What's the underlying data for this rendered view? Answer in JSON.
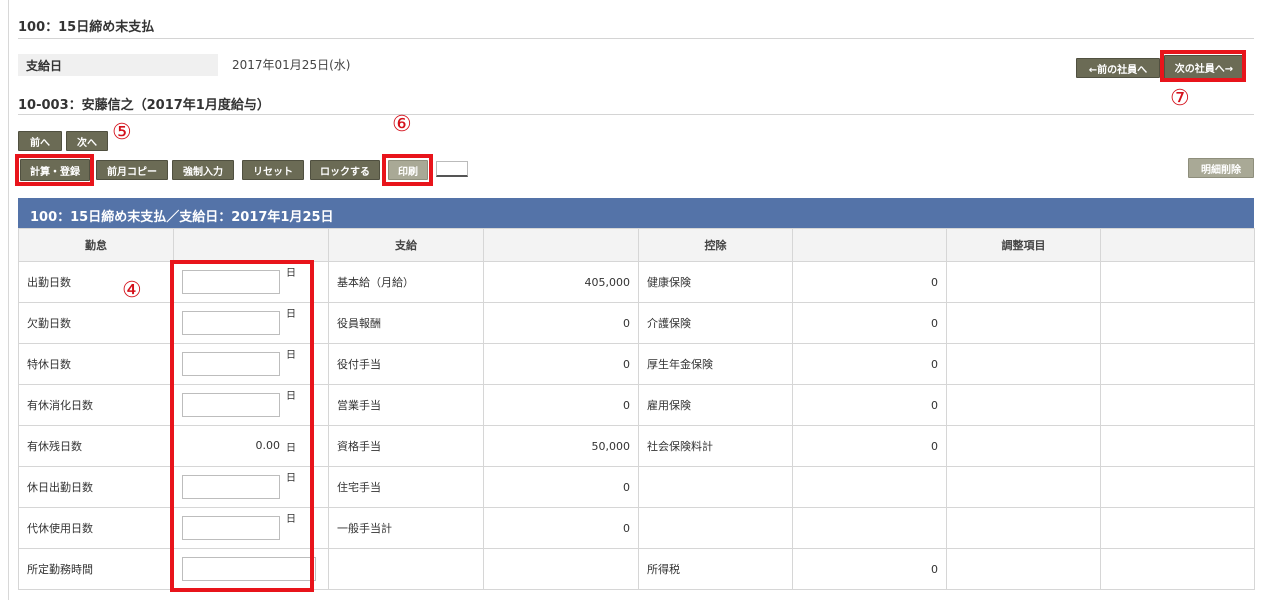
{
  "header": {
    "title": "100：15日締め末支払",
    "pay_date_label": "支給日",
    "pay_date_value": "2017年01月25日(水)",
    "employee_title": "10-003：安藤信之（2017年1月度給与）"
  },
  "nav": {
    "prev_employee": "←前の社員へ",
    "next_employee": "次の社員へ→",
    "prev": "前へ",
    "next": "次へ"
  },
  "toolbar": {
    "calc_register": "計算・登録",
    "copy_prev_month": "前月コピー",
    "force_input": "強制入力",
    "reset": "リセット",
    "lock": "ロックする",
    "print": "印刷",
    "delete_detail": "明細削除"
  },
  "markers": {
    "m4": "④",
    "m5": "⑤",
    "m6": "⑥",
    "m7": "⑦"
  },
  "banner": "100：15日締め末支払／支給日：2017年1月25日",
  "table": {
    "headers": {
      "attendance": "勤怠",
      "payment": "支給",
      "deduction": "控除",
      "adjustment": "調整項目"
    },
    "unit_day": "日",
    "rows": [
      {
        "att": "出勤日数",
        "pay": "基本給（月給）",
        "pay_val": "405,000",
        "ded": "健康保険",
        "ded_val": "0"
      },
      {
        "att": "欠勤日数",
        "pay": "役員報酬",
        "pay_val": "0",
        "ded": "介護保険",
        "ded_val": "0"
      },
      {
        "att": "特休日数",
        "pay": "役付手当",
        "pay_val": "0",
        "ded": "厚生年金保険",
        "ded_val": "0"
      },
      {
        "att": "有休消化日数",
        "pay": "営業手当",
        "pay_val": "0",
        "ded": "雇用保険",
        "ded_val": "0"
      },
      {
        "att": "有休残日数",
        "att_val": "0.00",
        "pay": "資格手当",
        "pay_val": "50,000",
        "ded": "社会保険料計",
        "ded_val": "0"
      },
      {
        "att": "休日出勤日数",
        "pay": "住宅手当",
        "pay_val": "0",
        "ded": "",
        "ded_val": ""
      },
      {
        "att": "代休使用日数",
        "pay": "一般手当計",
        "pay_val": "0",
        "ded": "",
        "ded_val": ""
      },
      {
        "att": "所定勤務時間",
        "pay": "",
        "pay_val": "",
        "ded": "所得税",
        "ded_val": "0"
      }
    ]
  },
  "colors": {
    "banner": "#5473a8",
    "button": "#6b6b55",
    "highlight": "#e8141b"
  }
}
